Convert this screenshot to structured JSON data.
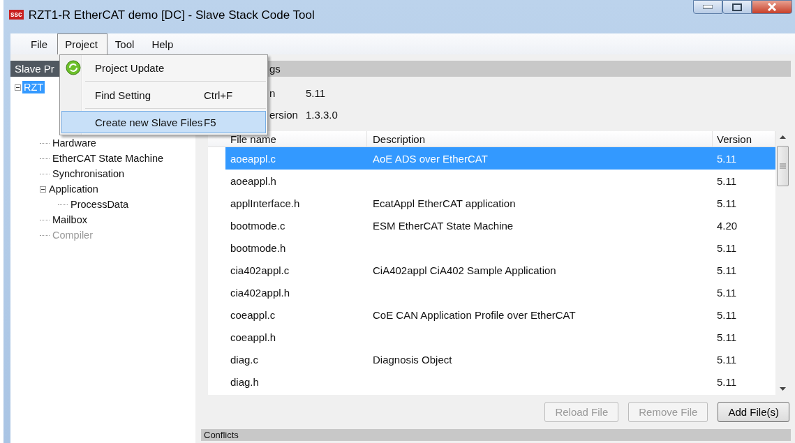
{
  "window": {
    "logo": "ssc",
    "title": "RZT1-R EtherCAT demo [DC] - Slave Stack Code Tool"
  },
  "menu_bar": [
    {
      "label": "File",
      "selected": false
    },
    {
      "label": "Project",
      "selected": true
    },
    {
      "label": "Tool",
      "selected": false
    },
    {
      "label": "Help",
      "selected": false
    }
  ],
  "open_menu": {
    "items": [
      {
        "kind": "icon_command",
        "label": "Project Update",
        "highlighted": false
      },
      {
        "kind": "separator"
      },
      {
        "kind": "command",
        "label": "Find Setting",
        "shortcut": "Ctrl+F",
        "highlighted": false
      },
      {
        "kind": "separator"
      },
      {
        "kind": "command",
        "label": "Create new Slave Files",
        "shortcut": "F5",
        "highlighted": true
      }
    ]
  },
  "sidebar": {
    "header": "Slave Pr",
    "tree": [
      {
        "label": "RZT",
        "selected": true,
        "expanded": true,
        "disabled": false,
        "children": [
          {
            "label": "Hardware",
            "selected": false,
            "disabled": false
          },
          {
            "label": "EtherCAT State Machine",
            "selected": false,
            "disabled": false
          },
          {
            "label": "Synchronisation",
            "selected": false,
            "disabled": false
          },
          {
            "label": "Application",
            "selected": false,
            "expanded": true,
            "disabled": false,
            "children": [
              {
                "label": "ProcessData",
                "selected": false,
                "disabled": false
              }
            ]
          },
          {
            "label": "Mailbox",
            "selected": false,
            "disabled": false
          },
          {
            "label": "Compiler",
            "selected": false,
            "disabled": true
          }
        ]
      }
    ]
  },
  "settings": {
    "header": "gs",
    "fields": [
      {
        "label": "n",
        "value": "5.11"
      },
      {
        "label": "ersion",
        "value": "1.3.3.0"
      }
    ]
  },
  "table": {
    "columns": [
      "File name",
      "Description",
      "Version"
    ],
    "rows": [
      {
        "cells": [
          "aoeappl.c",
          "AoE ADS over EtherCAT",
          "5.11"
        ],
        "selected": true
      },
      {
        "cells": [
          "aoeappl.h",
          "",
          "5.11"
        ],
        "selected": false
      },
      {
        "cells": [
          "applInterface.h",
          "EcatAppl EtherCAT application",
          "5.11"
        ],
        "selected": false
      },
      {
        "cells": [
          "bootmode.c",
          "ESM EtherCAT State Machine",
          "4.20"
        ],
        "selected": false
      },
      {
        "cells": [
          "bootmode.h",
          "",
          "5.11"
        ],
        "selected": false
      },
      {
        "cells": [
          "cia402appl.c",
          "CiA402appl CiA402 Sample Application",
          "5.11"
        ],
        "selected": false
      },
      {
        "cells": [
          "cia402appl.h",
          "",
          "5.11"
        ],
        "selected": false
      },
      {
        "cells": [
          "coeappl.c",
          "CoE CAN Application Profile over EtherCAT",
          "5.11"
        ],
        "selected": false
      },
      {
        "cells": [
          "coeappl.h",
          "",
          "5.11"
        ],
        "selected": false
      },
      {
        "cells": [
          "diag.c",
          "Diagnosis Object",
          "5.11"
        ],
        "selected": false
      },
      {
        "cells": [
          "diag.h",
          "",
          "5.11"
        ],
        "selected": false
      }
    ]
  },
  "buttons": [
    {
      "label": "Reload File",
      "disabled": true
    },
    {
      "label": "Remove File",
      "disabled": true
    },
    {
      "label": "Add File(s)",
      "disabled": false
    }
  ],
  "conflicts": {
    "header": "Conflicts"
  }
}
